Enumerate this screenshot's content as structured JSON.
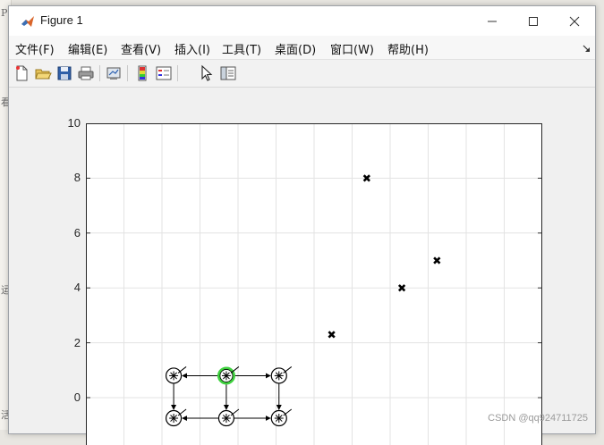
{
  "background": {
    "left_glyphs": [
      "P",
      "看",
      "运",
      "活"
    ]
  },
  "window": {
    "title": "Figure 1",
    "menus": [
      "文件(F)",
      "编辑(E)",
      "查看(V)",
      "插入(I)",
      "工具(T)",
      "桌面(D)",
      "窗口(W)",
      "帮助(H)"
    ],
    "toolbar_icons": [
      "new-figure-icon",
      "open-file-icon",
      "save-icon",
      "print-icon",
      "link-plot-icon",
      "insert-colorbar-icon",
      "insert-legend-icon",
      "edit-plot-arrow-icon",
      "property-inspector-icon"
    ]
  },
  "colors": {
    "marker": "#000000",
    "highlight": "#3fd13f",
    "grid": "#e3e3e3",
    "axes_bg": "#ffffff"
  },
  "chart_data": {
    "type": "scatter",
    "ylim": [
      -1,
      10
    ],
    "yticks": [
      0,
      2,
      4,
      6,
      8,
      10
    ],
    "xgrid_count": 12,
    "grid": true,
    "series": [
      {
        "marker": "x",
        "points": [
          {
            "x": 7.0,
            "y": 2.3
          },
          {
            "x": 8.0,
            "y": 8.0
          },
          {
            "x": 9.0,
            "y": 4.0
          },
          {
            "x": 10.0,
            "y": 5.0
          }
        ]
      },
      {
        "marker": "circled-star",
        "points": [
          {
            "x": 2.5,
            "y": 0.8
          },
          {
            "x": 4.0,
            "y": 0.8,
            "highlight": true
          },
          {
            "x": 5.5,
            "y": 0.8
          },
          {
            "x": 2.5,
            "y": -0.75
          },
          {
            "x": 4.0,
            "y": -0.75
          },
          {
            "x": 5.5,
            "y": -0.75
          }
        ]
      }
    ],
    "arrows": [
      {
        "from": 1,
        "to": 0
      },
      {
        "from": 1,
        "to": 2
      },
      {
        "from": 1,
        "to": 4
      },
      {
        "from": 0,
        "to": 3
      },
      {
        "from": 2,
        "to": 5
      },
      {
        "from": 4,
        "to": 3
      },
      {
        "from": 4,
        "to": 5
      }
    ],
    "xlim": [
      0,
      13
    ]
  },
  "watermark": "CSDN @qq924711725"
}
